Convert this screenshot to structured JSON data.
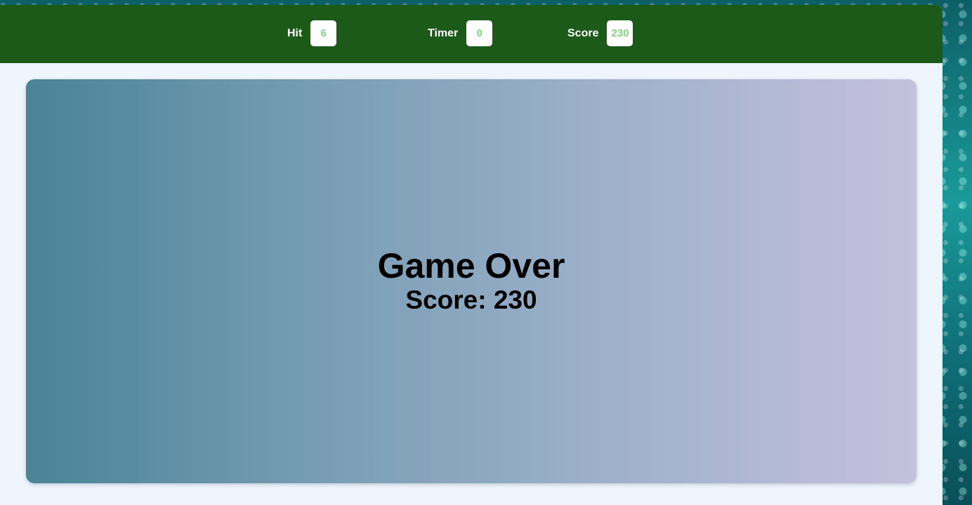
{
  "hud": {
    "hit": {
      "label": "Hit",
      "value": "6"
    },
    "timer": {
      "label": "Timer",
      "value": "0"
    },
    "score": {
      "label": "Score",
      "value": "230"
    }
  },
  "game": {
    "title": "Game Over",
    "final_score": "Score: 230"
  },
  "colors": {
    "top_bar": "#1c5a1a",
    "value_text": "#7fd27f",
    "panel_bg": "#eef5fd",
    "game_gradient_start": "#4a8396",
    "game_gradient_end": "#c4c1dc"
  }
}
